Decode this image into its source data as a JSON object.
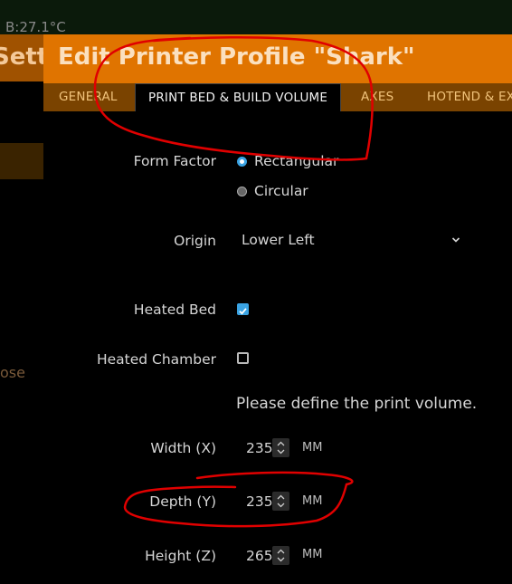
{
  "background": {
    "status_text": "B:27.1°C",
    "title_fragment": "Sett",
    "close_fragment": "ose"
  },
  "modal": {
    "title": "Edit Printer Profile \"Shark\"",
    "tabs": [
      "GENERAL",
      "PRINT BED & BUILD VOLUME",
      "AXES",
      "HOTEND & EX"
    ],
    "active_tab": "PRINT BED & BUILD VOLUME"
  },
  "form": {
    "form_factor": {
      "label": "Form Factor",
      "options": [
        "Rectangular",
        "Circular"
      ],
      "selected": "Rectangular"
    },
    "origin": {
      "label": "Origin",
      "value": "Lower Left"
    },
    "heated_bed": {
      "label": "Heated Bed",
      "checked": true
    },
    "heated_chamber": {
      "label": "Heated Chamber",
      "checked": false
    },
    "volume_note": "Please define the print volume.",
    "width": {
      "label": "Width (X)",
      "value": "235",
      "unit": "MM"
    },
    "depth": {
      "label": "Depth (Y)",
      "value": "235",
      "unit": "MM"
    },
    "height": {
      "label": "Height (Z)",
      "value": "265",
      "unit": "MM"
    }
  },
  "colors": {
    "header": "#e07400",
    "tab_bar": "#7a4300",
    "accent": "#3aa3e3",
    "annotation": "#e00000"
  }
}
